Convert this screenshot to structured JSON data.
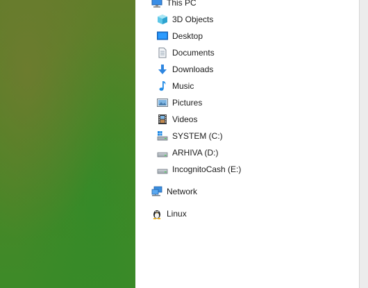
{
  "nav_pane": {
    "this_pc": {
      "label": "This PC",
      "icon": "computer-icon"
    },
    "items": [
      {
        "label": "3D Objects",
        "icon": "cube-3d-icon"
      },
      {
        "label": "Desktop",
        "icon": "desktop-icon"
      },
      {
        "label": "Documents",
        "icon": "documents-icon"
      },
      {
        "label": "Downloads",
        "icon": "download-arrow-icon"
      },
      {
        "label": "Music",
        "icon": "music-note-icon"
      },
      {
        "label": "Pictures",
        "icon": "pictures-icon"
      },
      {
        "label": "Videos",
        "icon": "film-strip-icon"
      },
      {
        "label": "SYSTEM (C:)",
        "icon": "system-drive-icon"
      },
      {
        "label": "ARHIVA (D:)",
        "icon": "drive-icon"
      },
      {
        "label": "IncognitoCash (E:)",
        "icon": "drive-icon"
      }
    ],
    "network": {
      "label": "Network",
      "icon": "network-icon"
    },
    "linux": {
      "label": "Linux",
      "icon": "tux-penguin-icon"
    }
  },
  "colors": {
    "accent": "#0078d7",
    "pane_bg": "#ffffff",
    "text": "#1a1a1a"
  }
}
